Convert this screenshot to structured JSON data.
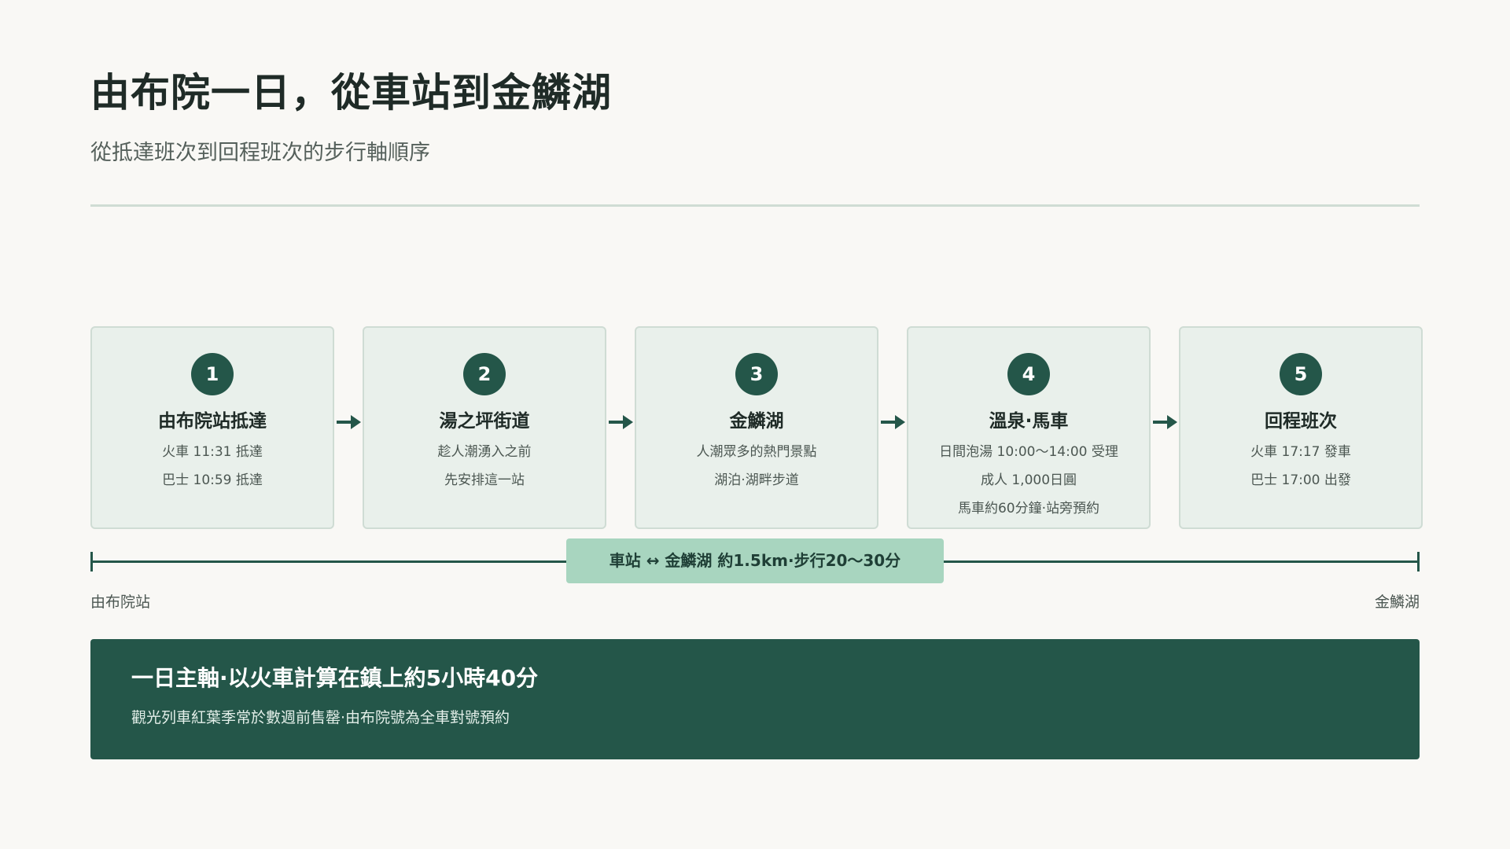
{
  "header": {
    "title": "由布院一日，從車站到金鱗湖",
    "subtitle": "從抵達班次到回程班次的步行軸順序"
  },
  "steps": [
    {
      "number": "1",
      "title": "由布院站抵達",
      "lines": [
        "火車 11:31 抵達",
        "巴士 10:59 抵達"
      ]
    },
    {
      "number": "2",
      "title": "湯之坪街道",
      "lines": [
        "趁人潮湧入之前",
        "先安排這一站"
      ]
    },
    {
      "number": "3",
      "title": "金鱗湖",
      "lines": [
        "人潮眾多的熱門景點",
        "湖泊·湖畔步道"
      ]
    },
    {
      "number": "4",
      "title": "溫泉·馬車",
      "lines": [
        "日間泡湯 10:00～14:00 受理",
        "成人 1,000日圓",
        "馬車約60分鐘·站旁預約"
      ]
    },
    {
      "number": "5",
      "title": "回程班次",
      "lines": [
        "火車 17:17 發車",
        "巴士 17:00 出發"
      ]
    }
  ],
  "axis": {
    "label": "車站 ↔ 金鱗湖 約1.5km·步行20～30分",
    "start": "由布院站",
    "end": "金鱗湖"
  },
  "summary": {
    "title": "一日主軸·以火車計算在鎮上約5小時40分",
    "text": "觀光列車紅葉季常於數週前售罄·由布院號為全車對號預約"
  },
  "colors": {
    "accent": "#245649",
    "card_bg": "#e9f0eb",
    "pill_bg": "#a8d5bf",
    "page_bg": "#f9f8f5"
  }
}
